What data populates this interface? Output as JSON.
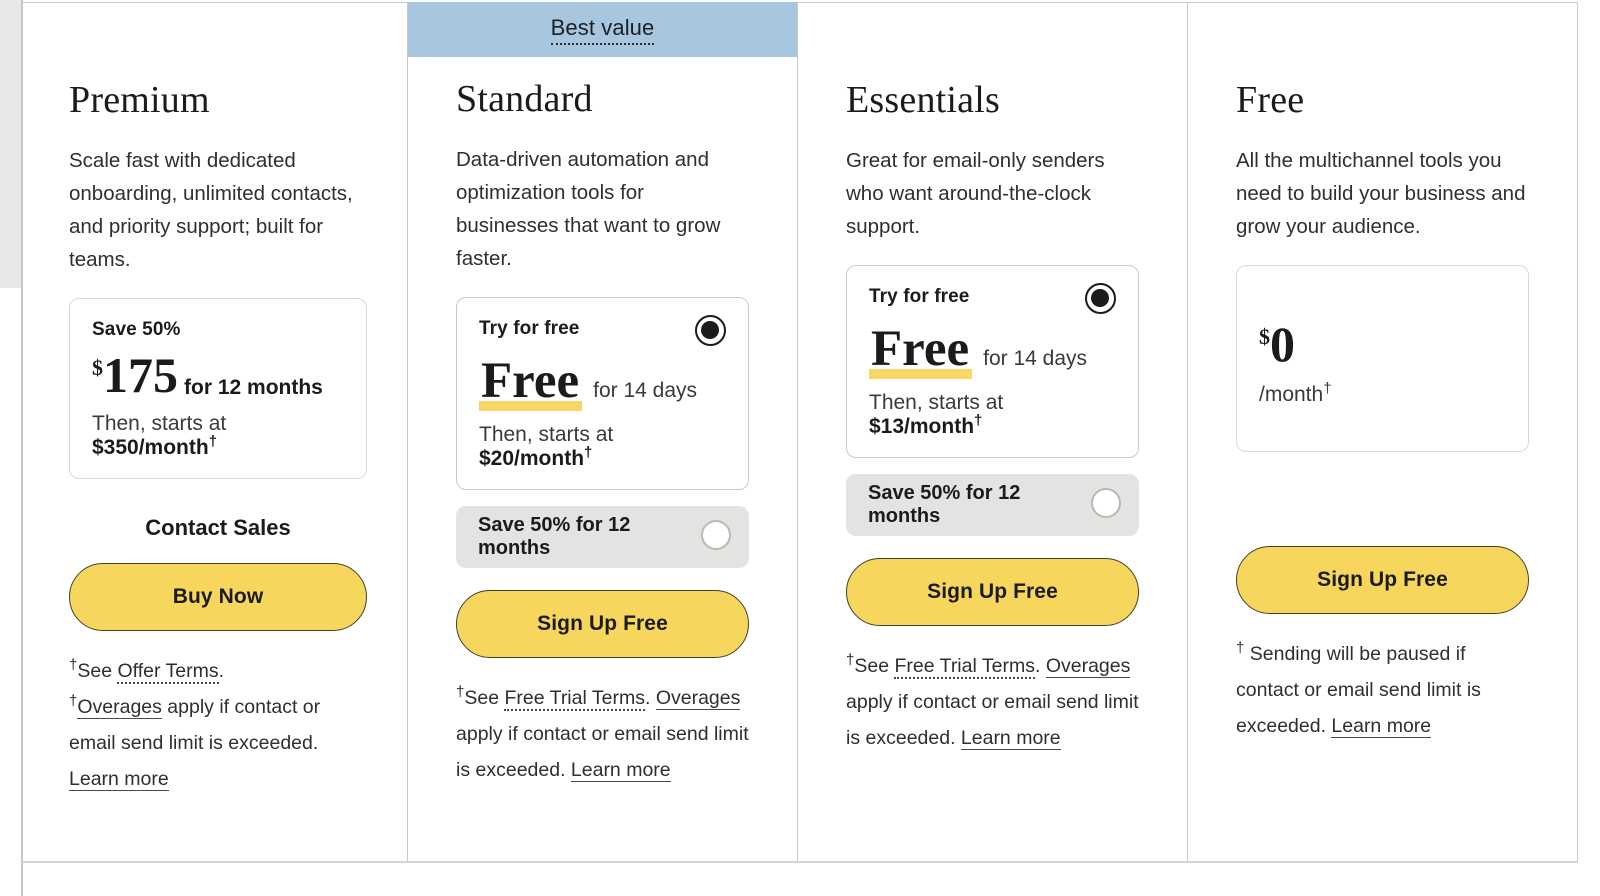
{
  "banner": {
    "best_value_label": "Best value"
  },
  "plans": [
    {
      "id": "premium",
      "title": "Premium",
      "description": "Scale fast with dedicated onboarding, unlimited contacts, and priority support; built for teams.",
      "price_panel": {
        "label": "Save 50%",
        "currency": "$",
        "amount": "175",
        "amount_suffix": "for 12 months",
        "then_prefix": "Then, starts at ",
        "then_price": "$350/month",
        "dagger": "†"
      },
      "contact_sales_label": "Contact Sales",
      "cta_label": "Buy Now",
      "fineprint": {
        "dagger": "†",
        "line1_prefix": "See ",
        "line1_link": "Offer Terms",
        "line1_suffix": ".",
        "line2_link": "Overages",
        "line2_text": " apply if contact or email send limit is exceeded. ",
        "learn_more": "Learn more"
      }
    },
    {
      "id": "standard",
      "title": "Standard",
      "description": "Data-driven automation and optimization tools for businesses that want to grow faster.",
      "price_panel": {
        "label": "Try for free",
        "free_word": "Free",
        "free_suffix": "for 14 days",
        "then_prefix": "Then, starts at ",
        "then_price": "$20/month",
        "dagger": "†",
        "selected": true
      },
      "option_row": {
        "label": "Save 50% for 12 months",
        "selected": false
      },
      "cta_label": "Sign Up Free",
      "fineprint": {
        "dagger": "†",
        "prefix": "See ",
        "terms_link": "Free Trial Terms",
        "mid": ". ",
        "overages_link": "Overages",
        "body": " apply if contact or email send limit is exceeded. ",
        "learn_more": "Learn more"
      }
    },
    {
      "id": "essentials",
      "title": "Essentials",
      "description": "Great for email-only senders who want around-the-clock support.",
      "price_panel": {
        "label": "Try for free",
        "free_word": "Free",
        "free_suffix": "for 14 days",
        "then_prefix": "Then, starts at ",
        "then_price": "$13/month",
        "dagger": "†",
        "selected": true
      },
      "option_row": {
        "label": "Save 50% for 12 months",
        "selected": false
      },
      "cta_label": "Sign Up Free",
      "fineprint": {
        "dagger": "†",
        "prefix": "See ",
        "terms_link": "Free Trial Terms",
        "mid": ". ",
        "overages_link": "Overages",
        "body": " apply if contact or email send limit is exceeded. ",
        "learn_more": "Learn more"
      }
    },
    {
      "id": "free",
      "title": "Free",
      "description": "All the multichannel tools you need to build your business and grow your audience.",
      "price_panel": {
        "currency": "$",
        "amount": "0",
        "per_month": "/month",
        "dagger": "†"
      },
      "cta_label": "Sign Up Free",
      "fineprint": {
        "dagger": "†",
        "body": " Sending will be paused if contact or email send limit is exceeded. ",
        "learn_more": "Learn more"
      }
    }
  ],
  "colors": {
    "banner_blue": "#a7c7e1",
    "cta_yellow": "#f7d65d",
    "highlight_yellow": "#f9d766",
    "option_gray": "#e3e3e1",
    "border_gray": "#c9c9c4"
  }
}
